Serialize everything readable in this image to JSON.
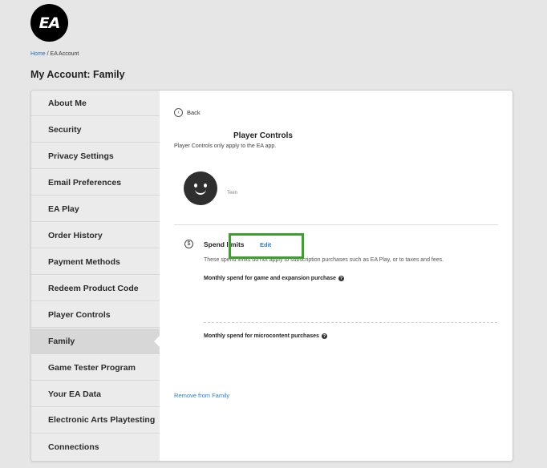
{
  "logo": {
    "text": "EA"
  },
  "breadcrumb": {
    "home": "Home",
    "separator": " / ",
    "current": "EA Account"
  },
  "page_title": "My Account: Family",
  "sidebar": {
    "items": [
      {
        "label": "About Me"
      },
      {
        "label": "Security"
      },
      {
        "label": "Privacy Settings"
      },
      {
        "label": "Email Preferences"
      },
      {
        "label": "EA Play"
      },
      {
        "label": "Order History"
      },
      {
        "label": "Payment Methods"
      },
      {
        "label": "Redeem Product Code"
      },
      {
        "label": "Player Controls"
      },
      {
        "label": "Family",
        "active": true
      },
      {
        "label": "Game Tester Program"
      },
      {
        "label": "Your EA Data"
      },
      {
        "label": "Electronic Arts Playtesting"
      },
      {
        "label": "Connections"
      }
    ]
  },
  "content": {
    "back_label": "Back",
    "back_icon": "chevron-left-icon",
    "title": "Player Controls",
    "subtitle": "Player Controls only apply to the EA app.",
    "avatar_label": "Teen",
    "spend": {
      "icon": "dollar-icon",
      "title": "Spend limits",
      "edit_label": "Edit",
      "description": "These spend limits do not apply to subscription purchases such as EA Play, or to taxes and fees.",
      "limit1_label": "Monthly spend for game and expansion purchase",
      "limit2_label": "Monthly spend for microcontent purchases"
    },
    "remove_label": "Remove from Family"
  },
  "colors": {
    "link": "#2a7fd4",
    "highlight": "#3aa22b",
    "background": "#e6e6e6"
  }
}
